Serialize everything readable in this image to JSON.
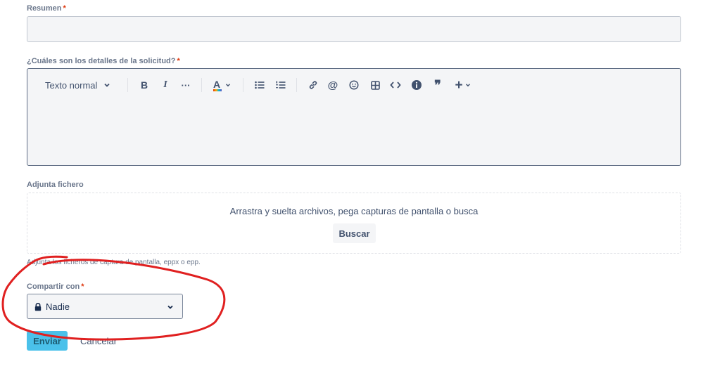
{
  "summary": {
    "label": "Resumen",
    "required_mark": "*",
    "value": ""
  },
  "details": {
    "label": "¿Cuáles son los detalles de la solicitud?",
    "required_mark": "*",
    "toolbar": {
      "text_style": "Texto normal",
      "bold": "B",
      "italic": "I",
      "more": "···",
      "text_color_letter": "A",
      "quote": "❞",
      "insert": "+"
    },
    "value": ""
  },
  "attachment": {
    "label": "Adjunta fichero",
    "drop_text": "Arrastra y suelta archivos, pega capturas de pantalla o busca",
    "browse_button": "Buscar",
    "hint": "Adjunta los ficheros de captura de pantalla, eppx o epp."
  },
  "share": {
    "label": "Compartir con",
    "required_mark": "*",
    "selected": "Nadie",
    "icon": "lock-icon"
  },
  "actions": {
    "submit": "Enviar",
    "cancel": "Cancelar"
  },
  "annotation": {
    "color": "#e02020"
  }
}
